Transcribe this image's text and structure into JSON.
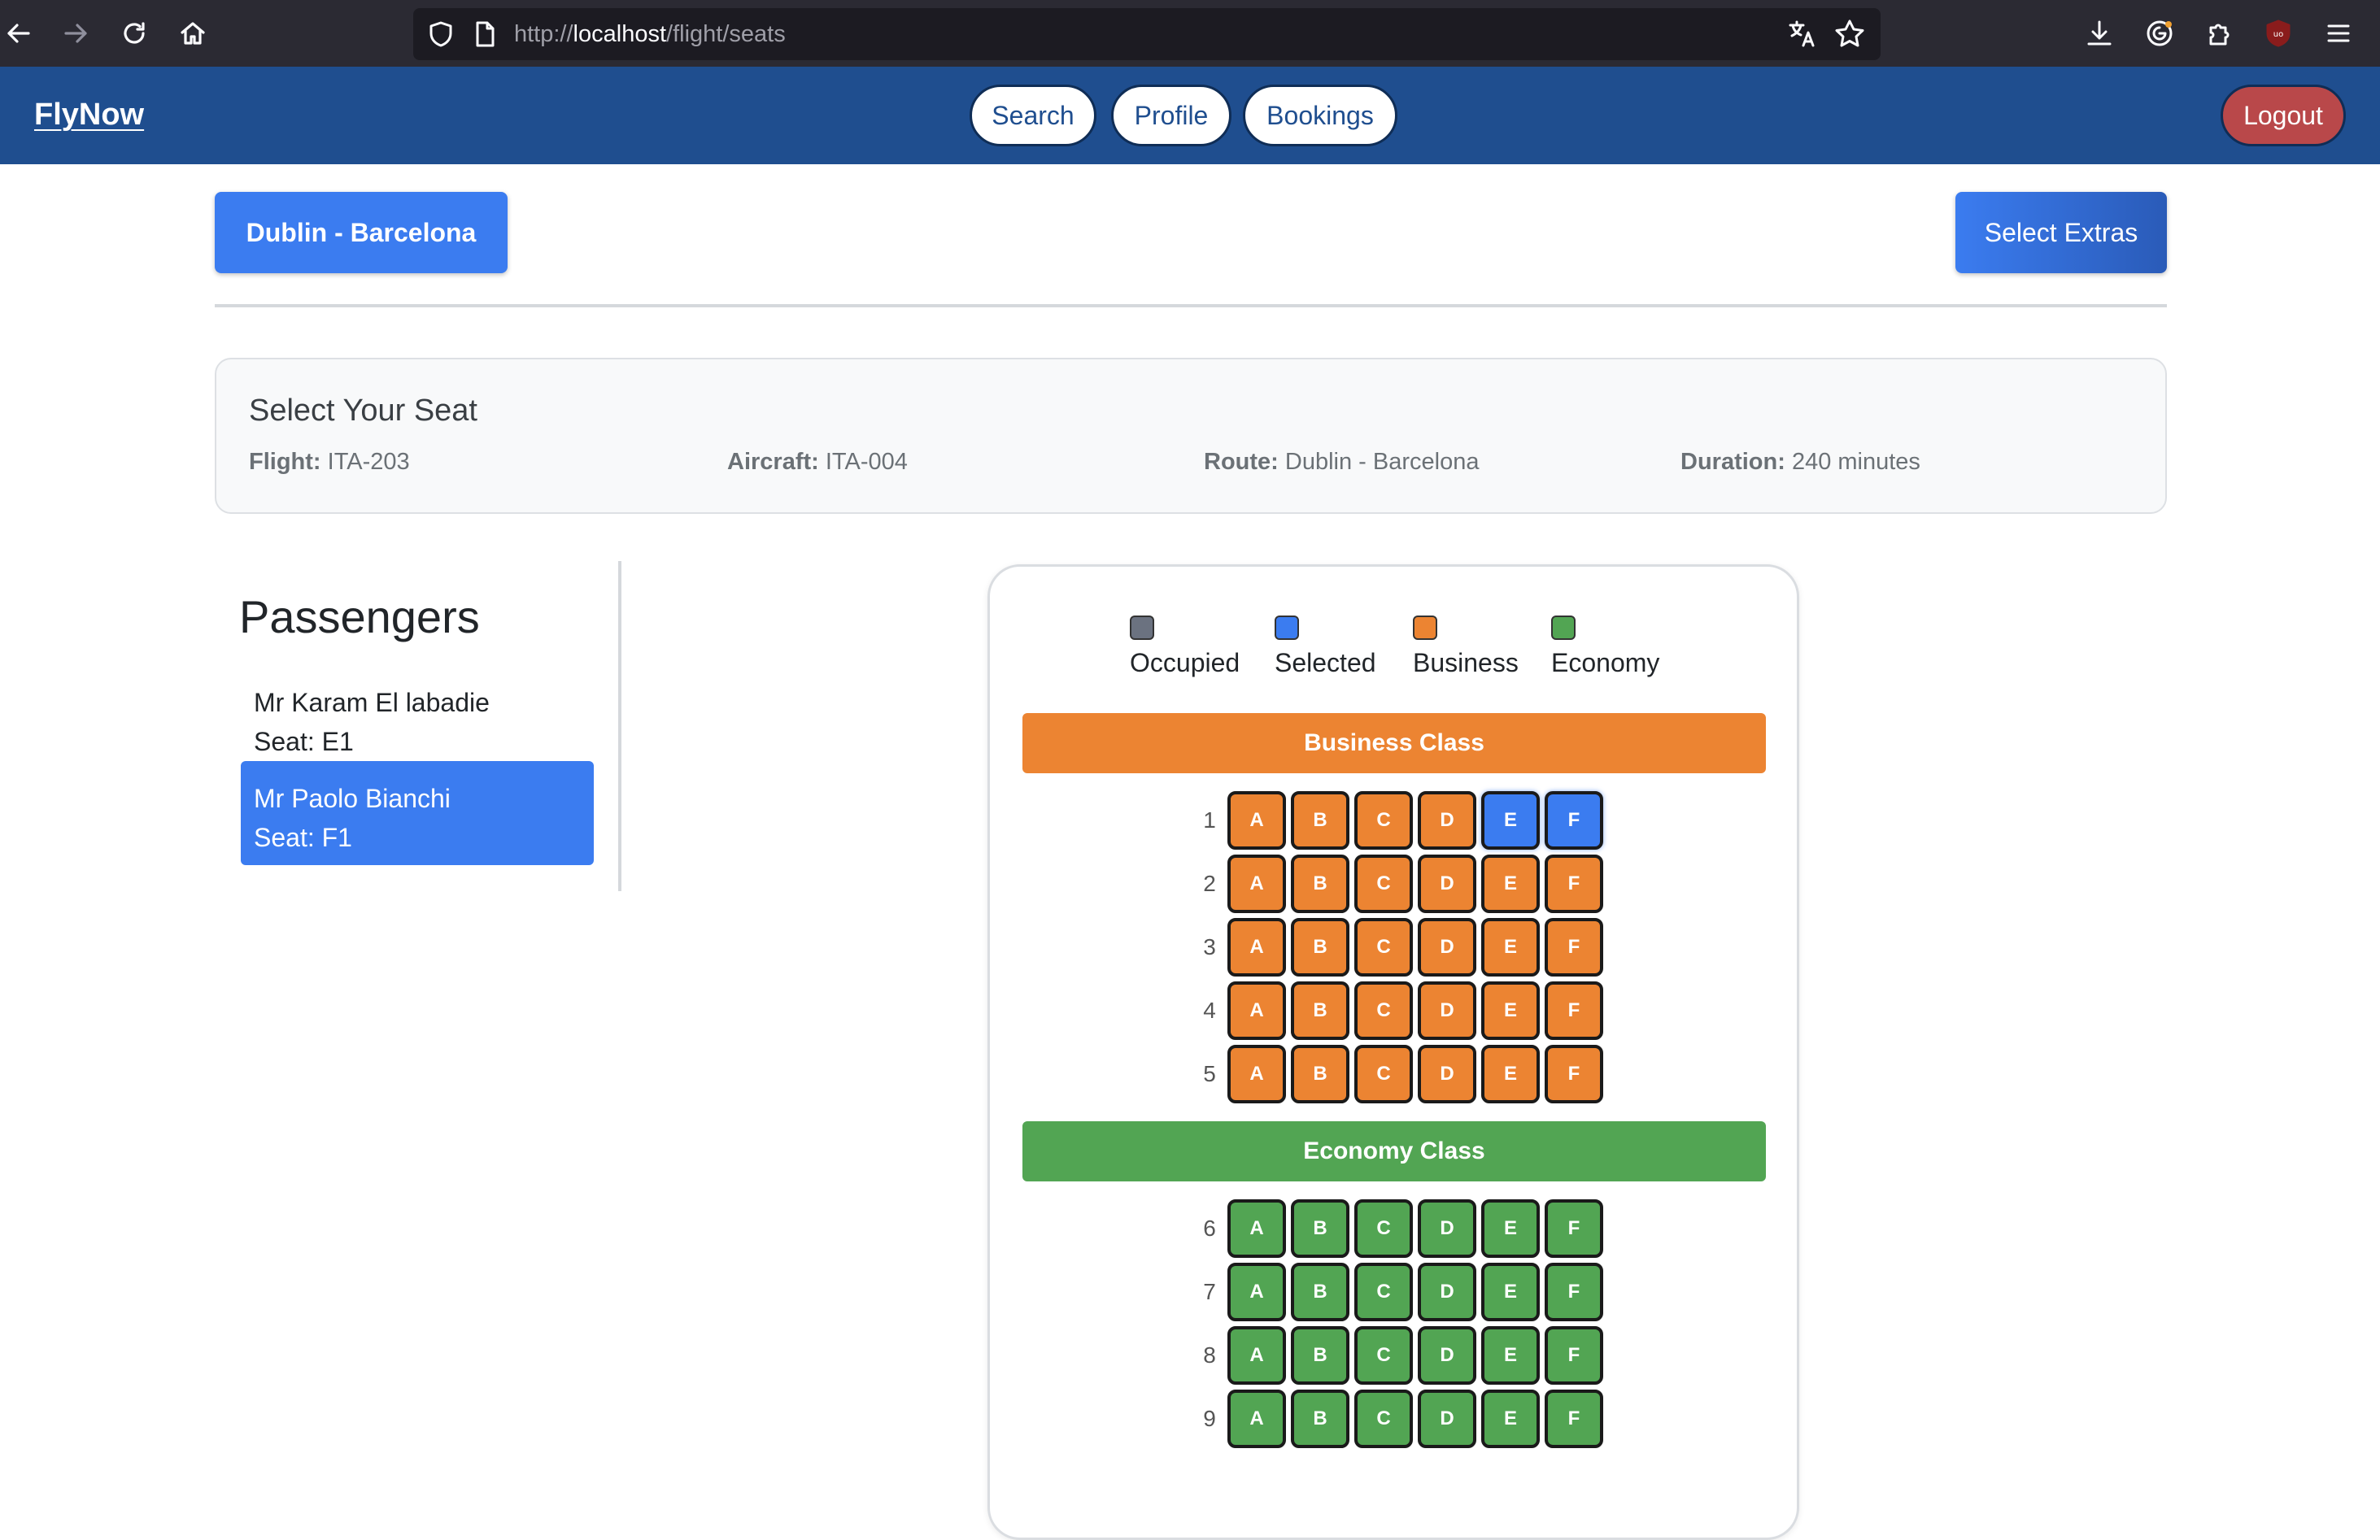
{
  "browser": {
    "url_prefix": "http://",
    "url_host": "localhost",
    "url_path": "/flight/seats"
  },
  "navbar": {
    "brand": "FlyNow",
    "links": [
      "Search",
      "Profile",
      "Bookings"
    ],
    "logout": "Logout"
  },
  "header": {
    "route_button": "Dublin - Barcelona",
    "extras_button": "Select Extras"
  },
  "flight_info": {
    "title": "Select Your Seat",
    "flight_label": "Flight:",
    "flight_value": "ITA-203",
    "aircraft_label": "Aircraft:",
    "aircraft_value": "ITA-004",
    "route_label": "Route:",
    "route_value": "Dublin - Barcelona",
    "duration_label": "Duration:",
    "duration_value": "240 minutes"
  },
  "passengers": {
    "heading": "Passengers",
    "items": [
      {
        "name": "Mr Karam El labadie",
        "seat": "Seat: E1",
        "active": false
      },
      {
        "name": "Mr Paolo Bianchi",
        "seat": "Seat: F1",
        "active": true
      }
    ]
  },
  "legend": [
    {
      "label": "Occupied",
      "color": "#6b7280"
    },
    {
      "label": "Selected",
      "color": "#3b7cf0"
    },
    {
      "label": "Business",
      "color": "#ec8432"
    },
    {
      "label": "Economy",
      "color": "#52a553"
    }
  ],
  "seat_map": {
    "columns": [
      "A",
      "B",
      "C",
      "D",
      "E",
      "F"
    ],
    "business": {
      "label": "Business Class",
      "color": "#ec8432",
      "rows": [
        1,
        2,
        3,
        4,
        5
      ]
    },
    "economy": {
      "label": "Economy Class",
      "color": "#52a553",
      "rows": [
        6,
        7,
        8,
        9
      ]
    },
    "selected": [
      "1E",
      "1F"
    ]
  }
}
